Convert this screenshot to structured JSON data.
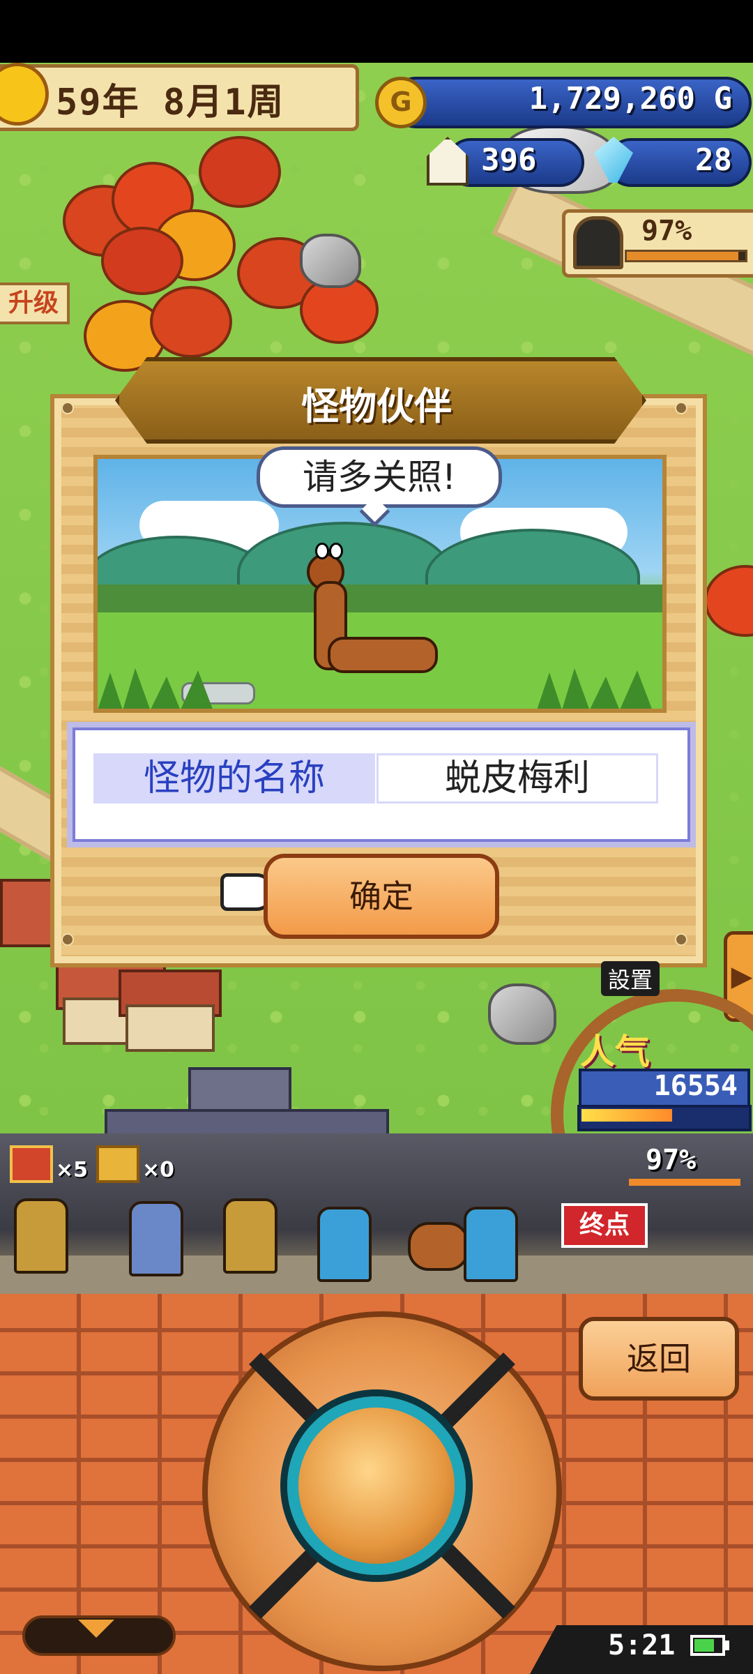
{
  "hud": {
    "year_week": "59年 8月1周",
    "gold": "1,729,260 G",
    "residents": "396",
    "crystals": "28",
    "dungeon_progress": "97%",
    "upgrade_tag": "升级"
  },
  "modal": {
    "title": "怪物伙伴",
    "speech": "请多关照!",
    "name_label": "怪物的名称",
    "name_value": "蜕皮梅利",
    "confirm_label": "确定"
  },
  "side": {
    "settings_label": "設置",
    "popularity_label": "人气",
    "popularity_value": "16554"
  },
  "expedition": {
    "chest_red_count": "×5",
    "chest_gold_count": "×0",
    "progress": "97%",
    "end_sign": "终点"
  },
  "controls": {
    "back_label": "返回",
    "clock": "5:21"
  },
  "colors": {
    "pill_blue": "#2b4fae",
    "name_label_text": "#2940c0",
    "button_orange": "#f39a48",
    "accent_teal": "#1fa6b8"
  },
  "icons": [
    "sun-icon",
    "coin-icon",
    "house-icon",
    "crystal-icon",
    "cave-icon",
    "pointing-hand-icon",
    "chest-icon",
    "battery-icon",
    "arrow-right-icon",
    "chevron-down-icon"
  ]
}
